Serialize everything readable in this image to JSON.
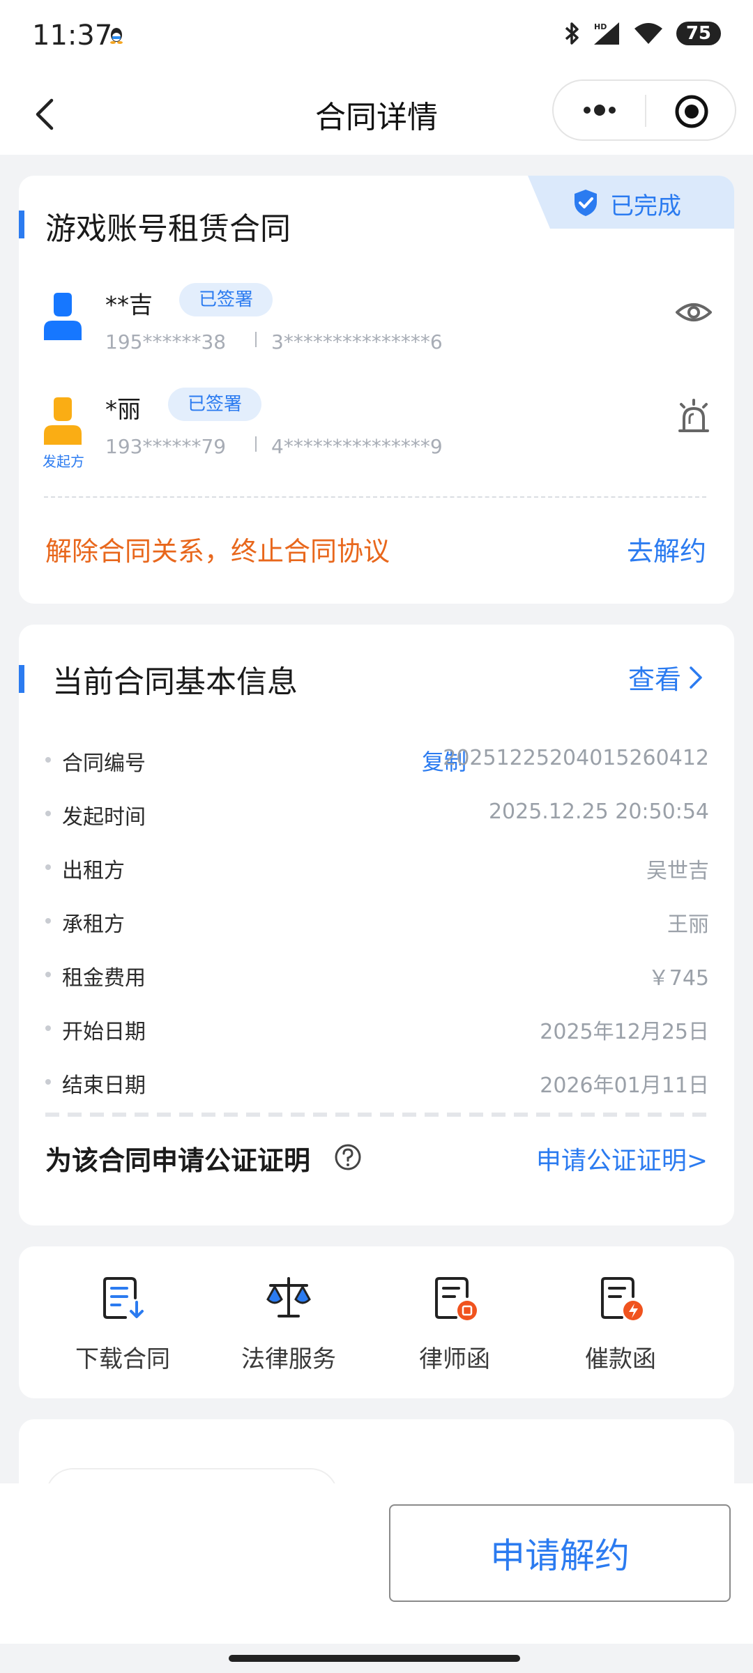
{
  "status_bar": {
    "time": "11:37",
    "battery": "75",
    "icons": [
      "qq-icon",
      "bluetooth-icon",
      "hd-signal-icon",
      "wifi-icon",
      "battery-icon"
    ]
  },
  "nav": {
    "title": "合同详情",
    "icons": [
      "back-icon",
      "more-icon",
      "close-circle-icon"
    ]
  },
  "contract": {
    "title": "游戏账号租赁合同",
    "status": "已完成",
    "parties": [
      {
        "name": "**吉",
        "signed": "已签署",
        "phone": "195******38",
        "id": "3***************6",
        "role": "",
        "avatar_color": "#1677ff",
        "action_icon": "eye-icon"
      },
      {
        "name": "*丽",
        "signed": "已签署",
        "phone": "193******79",
        "id": "4***************9",
        "role": "发起方",
        "avatar_color": "#faad14",
        "action_icon": "alarm-icon"
      }
    ],
    "terminate_text": "解除合同关系，终止合同协议",
    "terminate_link": "去解约"
  },
  "basic_info": {
    "title": "当前合同基本信息",
    "view_link": "查看",
    "copy": "复制",
    "rows": [
      {
        "label": "合同编号",
        "value": "20251225204015260412"
      },
      {
        "label": "发起时间",
        "value": "2025.12.25 20:50:54"
      },
      {
        "label": "出租方",
        "value": "吴世吉"
      },
      {
        "label": "承租方",
        "value": "王丽"
      },
      {
        "label": "租金费用",
        "value": "￥745"
      },
      {
        "label": "开始日期",
        "value": "2025年12月25日"
      },
      {
        "label": "结束日期",
        "value": "2026年01月11日"
      }
    ],
    "notary_title": "为该合同申请公证证明",
    "notary_link": "申请公证证明>"
  },
  "services": [
    {
      "label": "下载合同",
      "icon": "download-contract-icon"
    },
    {
      "label": "法律服务",
      "icon": "legal-scale-icon"
    },
    {
      "label": "律师函",
      "icon": "lawyer-letter-icon"
    },
    {
      "label": "催款函",
      "icon": "collection-letter-icon"
    }
  ],
  "bottom": {
    "apply_button": "申请解约"
  },
  "colors": {
    "accent": "#2b7bf0",
    "warning": "#e8671c",
    "muted": "#a7acb5",
    "background": "#f2f3f5"
  }
}
